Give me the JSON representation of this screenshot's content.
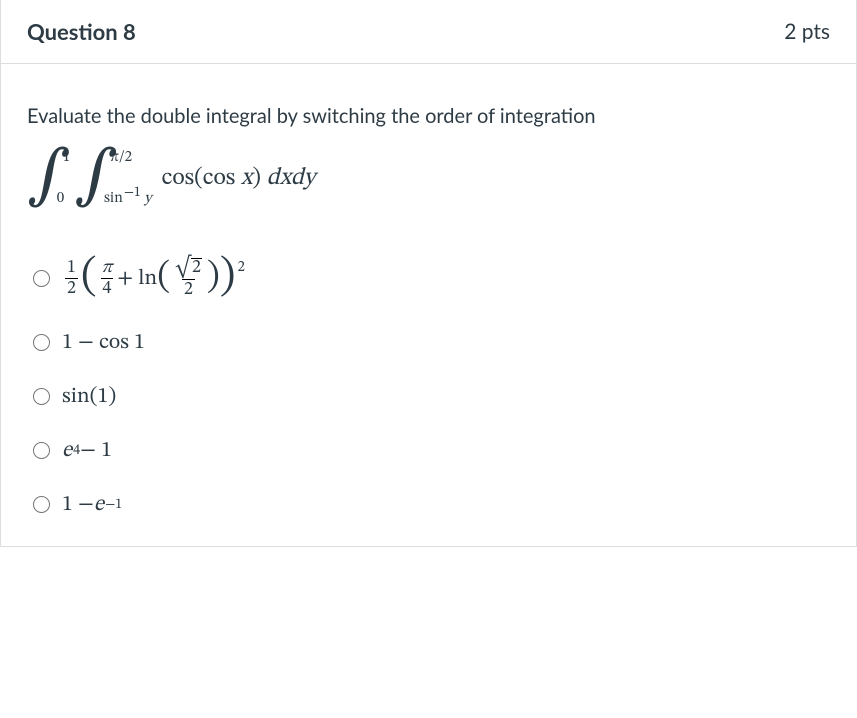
{
  "header": {
    "title": "Question 8",
    "points": "2 pts"
  },
  "prompt": "Evaluate the double integral by switching the order of integration",
  "integral": {
    "outer_int": "∫",
    "outer_lower": "0",
    "outer_upper": "1",
    "inner_int": "∫",
    "inner_lower_prefix": "sin",
    "inner_lower_exp": "−1",
    "inner_lower_suffix": " y",
    "inner_upper": "π/2",
    "integrand_cos1": "cos",
    "integrand_open": "(",
    "integrand_cos2": "cos ",
    "integrand_x": "x",
    "integrand_close": ")",
    "integrand_dxdy": " dxdy"
  },
  "options": {
    "a": {
      "half_num": "1",
      "half_den": "2",
      "pi4_num": "π",
      "pi4_den": "4",
      "plus_ln": " + ln",
      "sqrt_sign": "√",
      "sqrt_body": "2",
      "frac_den": "2",
      "outer_exp": "2"
    },
    "b": {
      "text_pre": "1 − cos 1"
    },
    "c": {
      "text": "sin(1)"
    },
    "d": {
      "e": "e",
      "exp": "4",
      "rest": " − 1"
    },
    "e": {
      "pre": "1 − ",
      "e": "e",
      "exp": "−1"
    }
  }
}
